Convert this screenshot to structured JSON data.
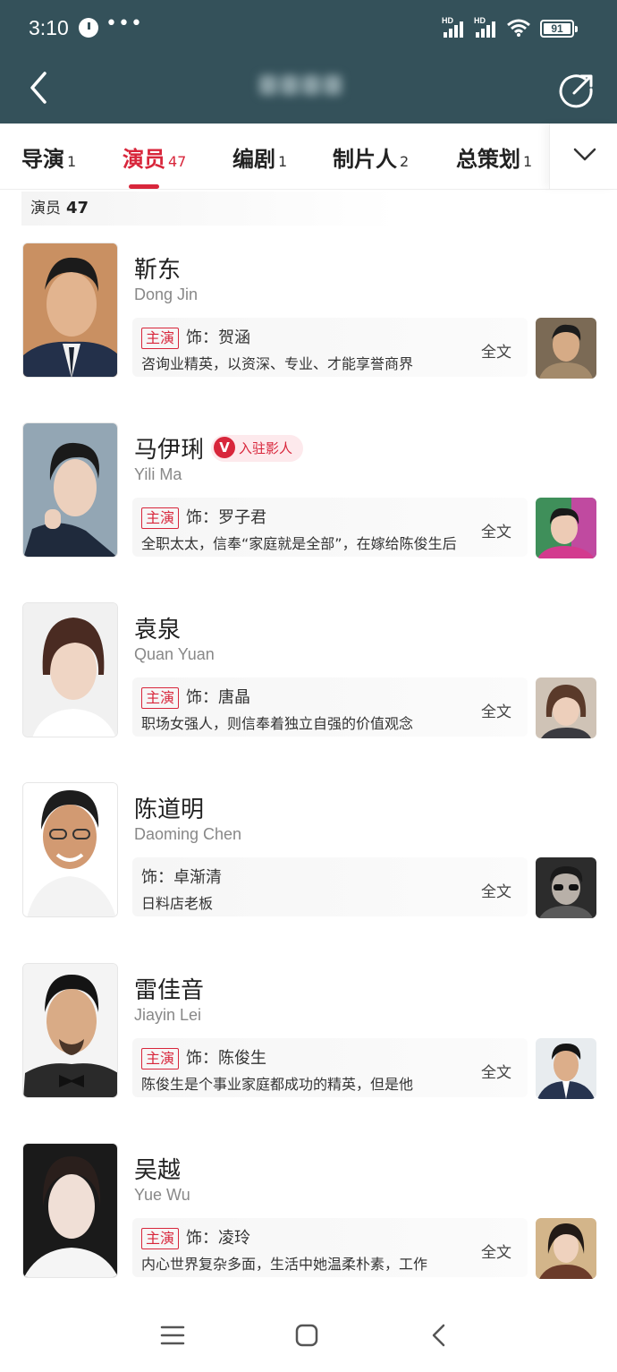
{
  "status_bar": {
    "time": "3:10",
    "dots": "•••",
    "hd1": "HD",
    "hd2": "HD",
    "battery": "91"
  },
  "header": {
    "title": "",
    "back_icon": "chevron-left-icon",
    "share_icon": "share-icon"
  },
  "tabs": [
    {
      "label": "导演",
      "count": "1"
    },
    {
      "label": "演员",
      "count": "47"
    },
    {
      "label": "编剧",
      "count": "1"
    },
    {
      "label": "制片人",
      "count": "2"
    },
    {
      "label": "总策划",
      "count": "1"
    }
  ],
  "active_tab": 1,
  "section": {
    "label": "演员",
    "count": "47"
  },
  "full_text_label": "全文",
  "actors": [
    {
      "name_cn": "靳东",
      "name_en": "Dong Jin",
      "badge": "",
      "lead_tag": "主演",
      "role": "饰：贺涵",
      "desc": "咨询业精英，以资深、专业、才能享誉商界"
    },
    {
      "name_cn": "马伊琍",
      "name_en": "Yili Ma",
      "badge": "入驻影人",
      "badge_v": "V",
      "lead_tag": "主演",
      "role": "饰：罗子君",
      "desc": "全职太太，信奉“家庭就是全部”，在嫁给陈俊生后"
    },
    {
      "name_cn": "袁泉",
      "name_en": "Quan Yuan",
      "badge": "",
      "lead_tag": "主演",
      "role": "饰：唐晶",
      "desc": "职场女强人，则信奉着独立自强的价值观念"
    },
    {
      "name_cn": "陈道明",
      "name_en": "Daoming Chen",
      "badge": "",
      "lead_tag": "",
      "role": "饰：卓渐清",
      "desc": "日料店老板"
    },
    {
      "name_cn": "雷佳音",
      "name_en": "Jiayin Lei",
      "badge": "",
      "lead_tag": "主演",
      "role": "饰：陈俊生",
      "desc": "陈俊生是个事业家庭都成功的精英，但是他"
    },
    {
      "name_cn": "吴越",
      "name_en": "Yue Wu",
      "badge": "",
      "lead_tag": "主演",
      "role": "饰：凌玲",
      "desc": "内心世界复杂多面，生活中她温柔朴素，工作"
    }
  ],
  "colors": {
    "header_bg": "#34515a",
    "accent": "#d8263b"
  },
  "nav": {
    "menu_icon": "menu-icon",
    "home_icon": "home-icon",
    "back_icon": "back-icon"
  }
}
